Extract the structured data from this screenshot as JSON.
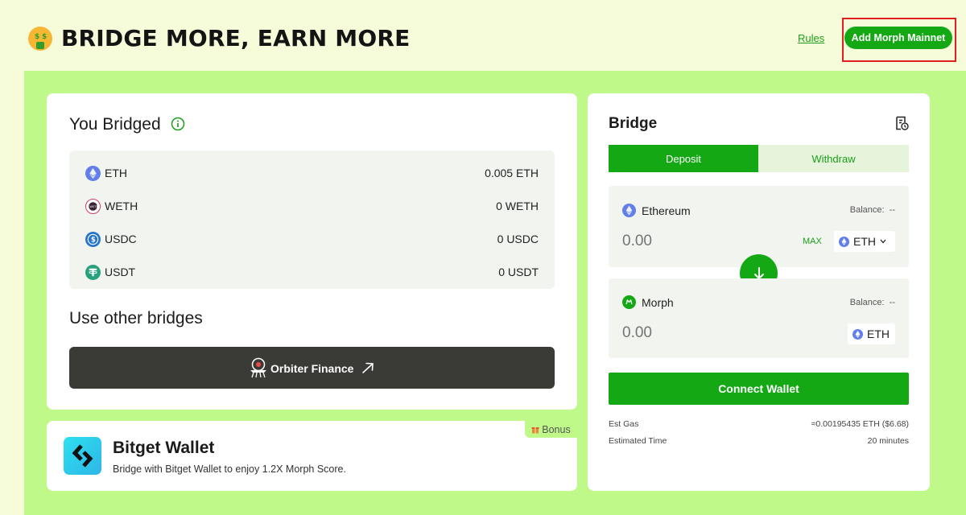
{
  "header": {
    "title": "BRIDGE MORE, EARN MORE",
    "emoji": "money-mouth-face-icon",
    "rules_label": "Rules",
    "add_network_label": "Add Morph Mainnet"
  },
  "you_bridged": {
    "title": "You Bridged",
    "tokens": [
      {
        "name": "ETH",
        "amount": "0.005 ETH",
        "icon": "eth-icon"
      },
      {
        "name": "WETH",
        "amount": "0 WETH",
        "icon": "weth-icon"
      },
      {
        "name": "USDC",
        "amount": "0 USDC",
        "icon": "usdc-icon"
      },
      {
        "name": "USDT",
        "amount": "0 USDT",
        "icon": "usdt-icon"
      }
    ]
  },
  "other_bridges": {
    "title": "Use other bridges",
    "orbiter_label": "Orbiter Finance"
  },
  "bitget": {
    "badge": "Bonus",
    "title": "Bitget Wallet",
    "description": "Bridge with Bitget Wallet to enjoy 1.2X Morph Score."
  },
  "bridge": {
    "title": "Bridge",
    "tabs": {
      "deposit": "Deposit",
      "withdraw": "Withdraw"
    },
    "from": {
      "chain": "Ethereum",
      "balance_label": "Balance:",
      "balance_value": "--",
      "placeholder": "0.00",
      "max_label": "MAX",
      "token": "ETH"
    },
    "to": {
      "chain": "Morph",
      "balance_label": "Balance:",
      "balance_value": "--",
      "placeholder": "0.00",
      "token": "ETH"
    },
    "connect_label": "Connect Wallet",
    "est_gas_label": "Est Gas",
    "est_gas_value": "≈0.00195435 ETH ($6.68)",
    "est_time_label": "Estimated Time",
    "est_time_value": "20 minutes"
  },
  "colors": {
    "brand_green": "#14a814",
    "lime_panel": "#bef98a",
    "page_bg": "#f6fbd9",
    "highlight_border": "#e02020"
  }
}
